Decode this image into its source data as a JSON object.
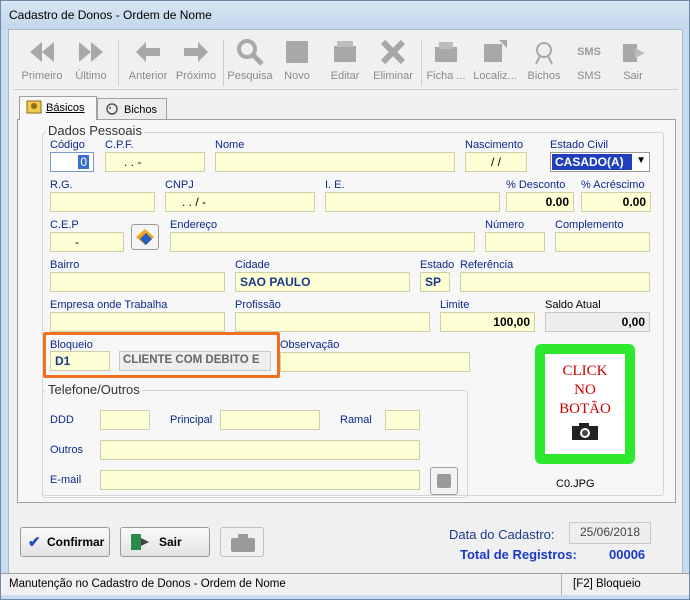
{
  "window": {
    "title": "Cadastro de Donos - Ordem de Nome"
  },
  "toolbar": {
    "buttons": [
      {
        "label": "Primeiro",
        "icon": "first-icon"
      },
      {
        "label": "Último",
        "icon": "last-icon"
      },
      {
        "label": "Anterior",
        "icon": "previous-icon"
      },
      {
        "label": "Próximo",
        "icon": "next-icon"
      },
      {
        "label": "Pesquisa",
        "icon": "search-icon"
      },
      {
        "label": "Novo",
        "icon": "new-icon"
      },
      {
        "label": "Editar",
        "icon": "edit-icon"
      },
      {
        "label": "Eliminar",
        "icon": "delete-icon"
      },
      {
        "label": "Ficha ...",
        "icon": "record-card-icon"
      },
      {
        "label": "Localiz...",
        "icon": "locate-icon"
      },
      {
        "label": "Bichos",
        "icon": "pets-icon"
      },
      {
        "label": "SMS",
        "icon": "sms-icon"
      },
      {
        "label": "Sair",
        "icon": "exit-icon"
      }
    ]
  },
  "tabs": [
    {
      "label": "Básicos"
    },
    {
      "label": "Bichos"
    }
  ],
  "dados_pessoais": {
    "legend": "Dados Pessoais",
    "codigo": {
      "label": "Código",
      "value": "0"
    },
    "cpf": {
      "label": "C.P.F.",
      "value": ". . -"
    },
    "nome": {
      "label": "Nome",
      "value": ""
    },
    "nascimento": {
      "label": "Nascimento",
      "value": "/ /"
    },
    "estado_civil": {
      "label": "Estado Civil",
      "value": "CASADO(A)"
    },
    "rg": {
      "label": "R.G.",
      "value": ""
    },
    "cnpj": {
      "label": "CNPJ",
      "value": ". . / -"
    },
    "ie": {
      "label": "I. E.",
      "value": ""
    },
    "desconto": {
      "label": "% Desconto",
      "value": "0.00"
    },
    "acrescimo": {
      "label": "% Acréscimo",
      "value": "0.00"
    },
    "cep": {
      "label": "C.E.P",
      "value": "-"
    },
    "endereco": {
      "label": "Endereço",
      "value": ""
    },
    "numero": {
      "label": "Número",
      "value": ""
    },
    "complemento": {
      "label": "Complemento",
      "value": ""
    },
    "bairro": {
      "label": "Bairro",
      "value": ""
    },
    "cidade": {
      "label": "Cidade",
      "value": "SAO PAULO"
    },
    "estado": {
      "label": "Estado",
      "value": "SP"
    },
    "referencia": {
      "label": "Referência",
      "value": ""
    },
    "empresa": {
      "label": "Empresa onde Trabalha",
      "value": ""
    },
    "profissao": {
      "label": "Profissão",
      "value": ""
    },
    "limite": {
      "label": "Limite",
      "value": "100,00"
    },
    "saldo": {
      "label": "Saldo Atual",
      "value": "0,00"
    },
    "bloqueio": {
      "label": "Bloqueio",
      "code": "D1",
      "description": "CLIENTE COM DEBITO E"
    },
    "observacao": {
      "label": "Observação",
      "value": ""
    }
  },
  "telefone": {
    "legend": "Telefone/Outros",
    "ddd": {
      "label": "DDD",
      "value": ""
    },
    "principal": {
      "label": "Principal",
      "value": ""
    },
    "ramal": {
      "label": "Ramal",
      "value": ""
    },
    "outros": {
      "label": "Outros",
      "value": ""
    },
    "email": {
      "label": "E-mail",
      "value": ""
    }
  },
  "photo": {
    "text_line1": "CLICK",
    "text_line2": "NO",
    "text_line3": "BOTÃO",
    "caption": "C0.JPG"
  },
  "bottom": {
    "confirm_label": "Confirmar",
    "exit_label": "Sair",
    "data_cadastro_label": "Data do Cadastro:",
    "data_cadastro_value": "25/06/2018",
    "total_label": "Total de Registros:",
    "total_value": "00006"
  },
  "status": {
    "left": "Manutenção no Cadastro de Donos - Ordem de Nome",
    "right": "[F2] Bloqueio"
  },
  "colors": {
    "field_bg": "#ffffd6",
    "highlight_border": "#f07020",
    "photo_frame": "#22dd22",
    "photo_text": "#cc0000",
    "label_blue": "#0a2a8a"
  }
}
